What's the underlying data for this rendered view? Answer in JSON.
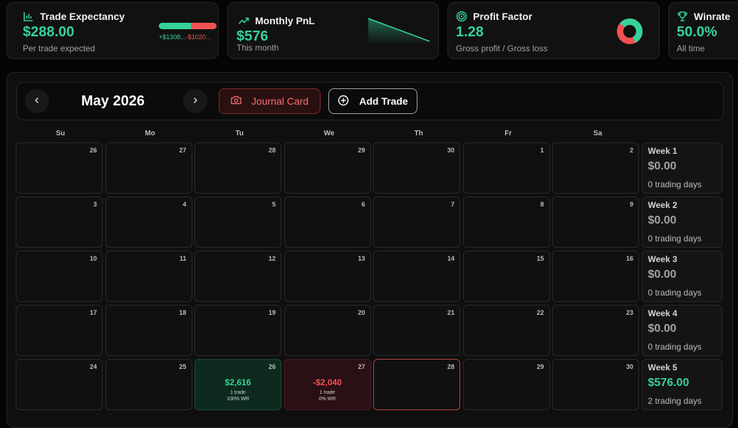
{
  "stats": {
    "expectancy": {
      "title": "Trade Expectancy",
      "value": "$288.00",
      "subtitle": "Per trade expected",
      "win_label": "+$1308...",
      "loss_label": "-$1020...",
      "win_share": 0.56
    },
    "monthly": {
      "title": "Monthly PnL",
      "value": "$576",
      "subtitle": "This month"
    },
    "profit_factor": {
      "title": "Profit Factor",
      "value": "1.28",
      "subtitle": "Gross profit / Gross loss",
      "gross_profit_share": 0.56
    },
    "winrate": {
      "title": "Winrate",
      "value": "50.0%",
      "subtitle": "All time"
    }
  },
  "calendar": {
    "month_label": "May 2026",
    "journal_card_label": "Journal Card",
    "add_trade_label": "Add Trade",
    "weekdays": [
      "Su",
      "Mo",
      "Tu",
      "We",
      "Th",
      "Fr",
      "Sa"
    ],
    "weeks": [
      {
        "days": [
          {
            "num": "26"
          },
          {
            "num": "27"
          },
          {
            "num": "28"
          },
          {
            "num": "29"
          },
          {
            "num": "30"
          },
          {
            "num": "1"
          },
          {
            "num": "2"
          }
        ],
        "summary": {
          "label": "Week 1",
          "value": "$0.00",
          "days": "0 trading days",
          "positive": false
        }
      },
      {
        "days": [
          {
            "num": "3"
          },
          {
            "num": "4"
          },
          {
            "num": "5"
          },
          {
            "num": "6"
          },
          {
            "num": "7"
          },
          {
            "num": "8"
          },
          {
            "num": "9"
          }
        ],
        "summary": {
          "label": "Week 2",
          "value": "$0.00",
          "days": "0 trading days",
          "positive": false
        }
      },
      {
        "days": [
          {
            "num": "10"
          },
          {
            "num": "11"
          },
          {
            "num": "12"
          },
          {
            "num": "13"
          },
          {
            "num": "14"
          },
          {
            "num": "15"
          },
          {
            "num": "16"
          }
        ],
        "summary": {
          "label": "Week 3",
          "value": "$0.00",
          "days": "0 trading days",
          "positive": false
        }
      },
      {
        "days": [
          {
            "num": "17"
          },
          {
            "num": "18"
          },
          {
            "num": "19"
          },
          {
            "num": "20"
          },
          {
            "num": "21"
          },
          {
            "num": "22"
          },
          {
            "num": "23"
          }
        ],
        "summary": {
          "label": "Week 4",
          "value": "$0.00",
          "days": "0 trading days",
          "positive": false
        }
      },
      {
        "days": [
          {
            "num": "24"
          },
          {
            "num": "25"
          },
          {
            "num": "26",
            "status": "profit",
            "pnl": "$2,616",
            "trades": "1 trade",
            "wr": "100% WR"
          },
          {
            "num": "27",
            "status": "loss",
            "pnl": "-$2,040",
            "trades": "1 trade",
            "wr": "0% WR"
          },
          {
            "num": "28",
            "today": true
          },
          {
            "num": "29"
          },
          {
            "num": "30"
          }
        ],
        "summary": {
          "label": "Week 5",
          "value": "$576.00",
          "days": "2 trading days",
          "positive": true
        }
      }
    ]
  },
  "colors": {
    "green": "#34d399",
    "red": "#f05252",
    "background": "#050505",
    "panel": "#0f0f0f"
  },
  "icons": {
    "expectancy": "bar-chart-icon",
    "monthly": "trending-up-icon",
    "profit_factor": "target-icon",
    "winrate": "trophy-icon",
    "prev": "chevron-left-icon",
    "next": "chevron-right-icon",
    "journal": "camera-icon",
    "add": "plus-circle-icon"
  }
}
